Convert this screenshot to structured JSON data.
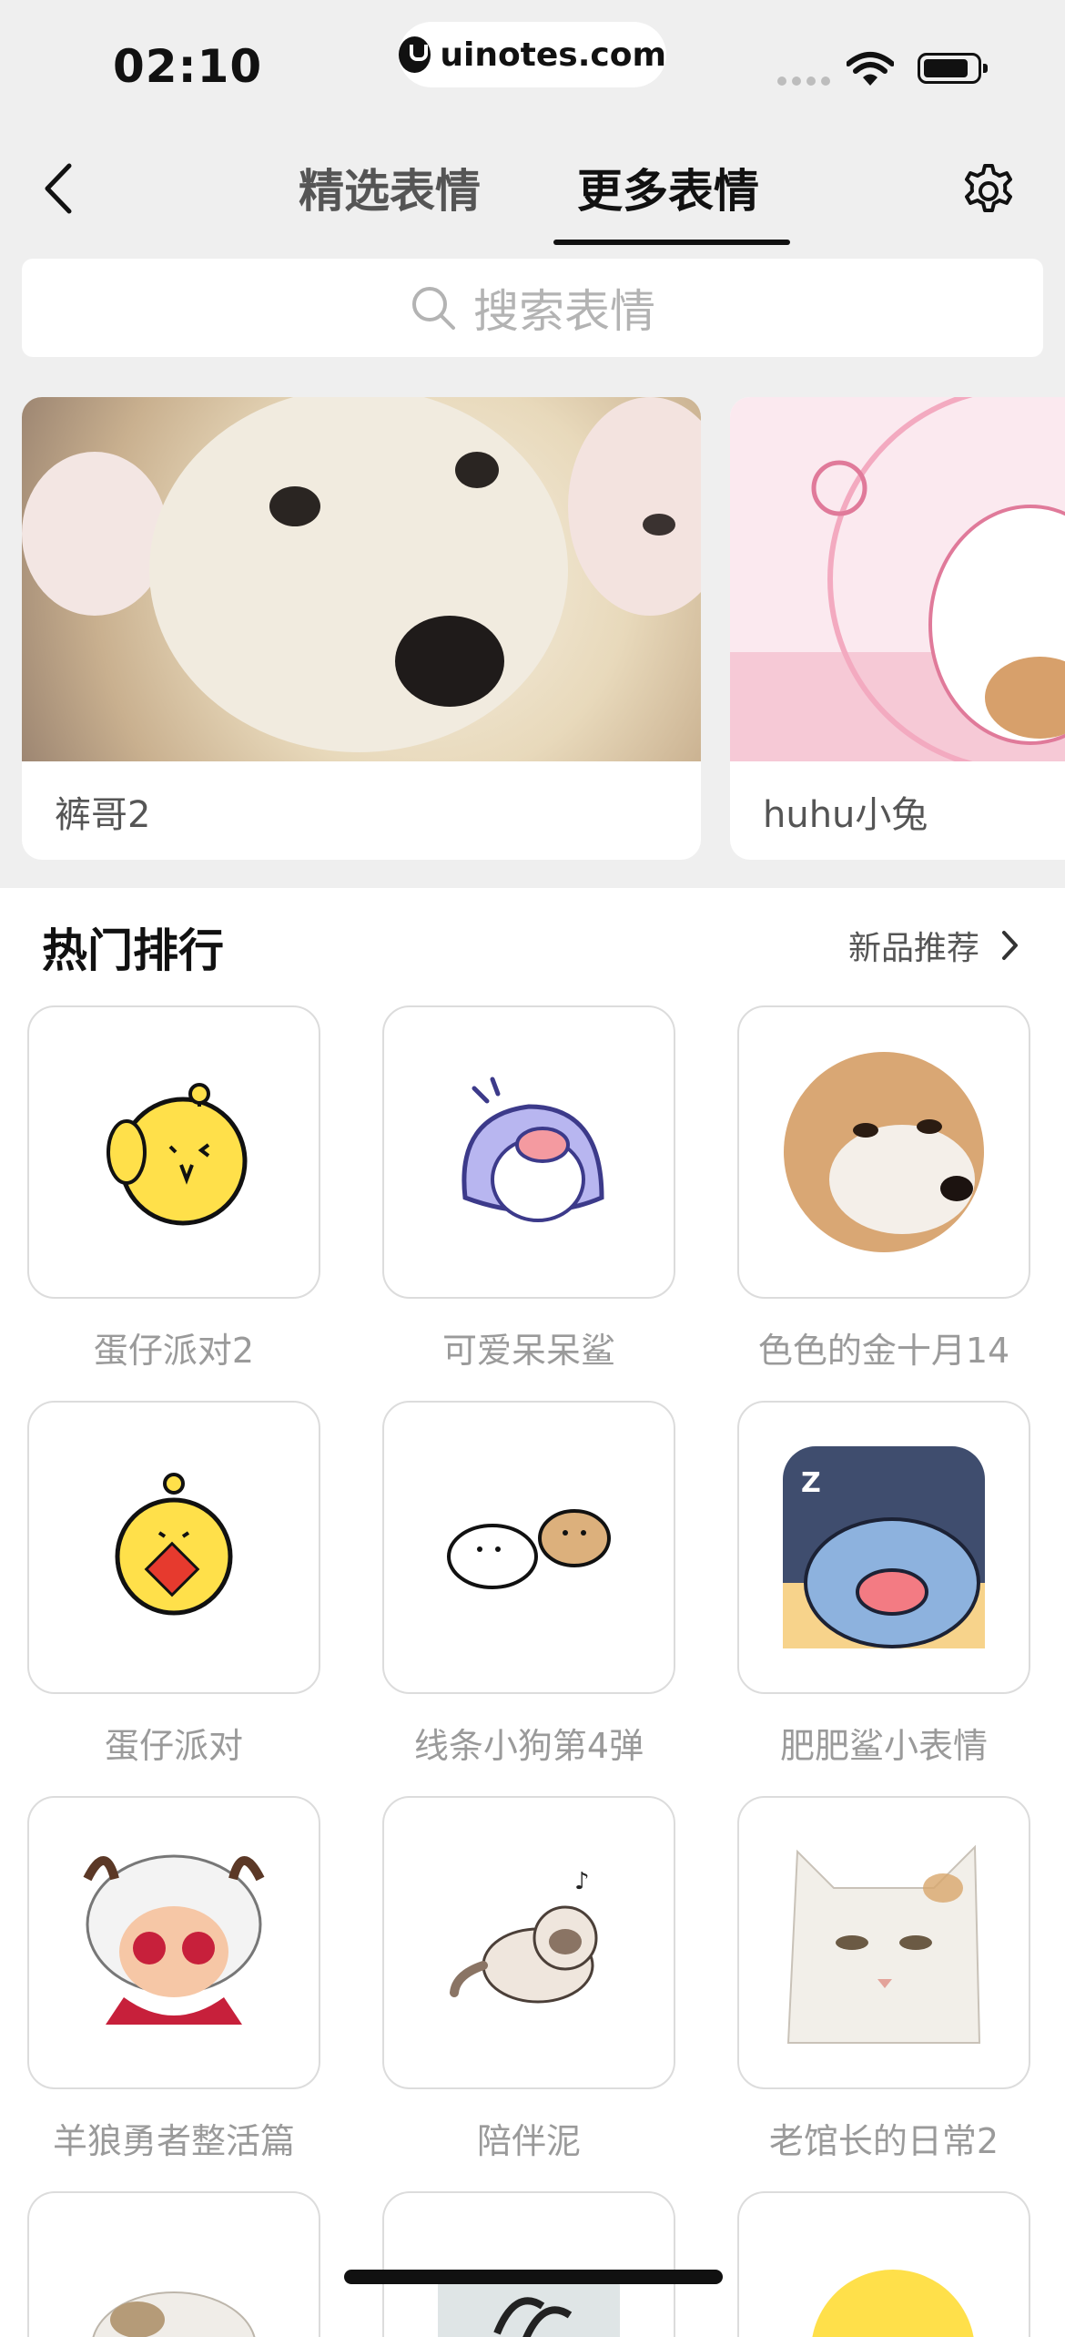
{
  "status": {
    "time": "02:10",
    "url": "uinotes.com"
  },
  "nav": {
    "tab_featured": "精选表情",
    "tab_more": "更多表情"
  },
  "search": {
    "placeholder": "搜索表情"
  },
  "banners": [
    {
      "name": "裤哥2"
    },
    {
      "name": "huhu小兔"
    }
  ],
  "hot": {
    "title": "热门排行",
    "new_link": "新品推荐",
    "items": [
      "蛋仔派对2",
      "可爱呆呆鲨",
      "色色的金十月14",
      "蛋仔派对",
      "线条小狗第4弹",
      "肥肥鲨小表情",
      "羊狼勇者整活篇",
      "陪伴泥",
      "老馆长的日常2"
    ]
  },
  "colors": {
    "background": "#efefef",
    "card_border": "#dcdcdc",
    "label_gray": "#9a9a9a",
    "active_tab": "#111111"
  }
}
